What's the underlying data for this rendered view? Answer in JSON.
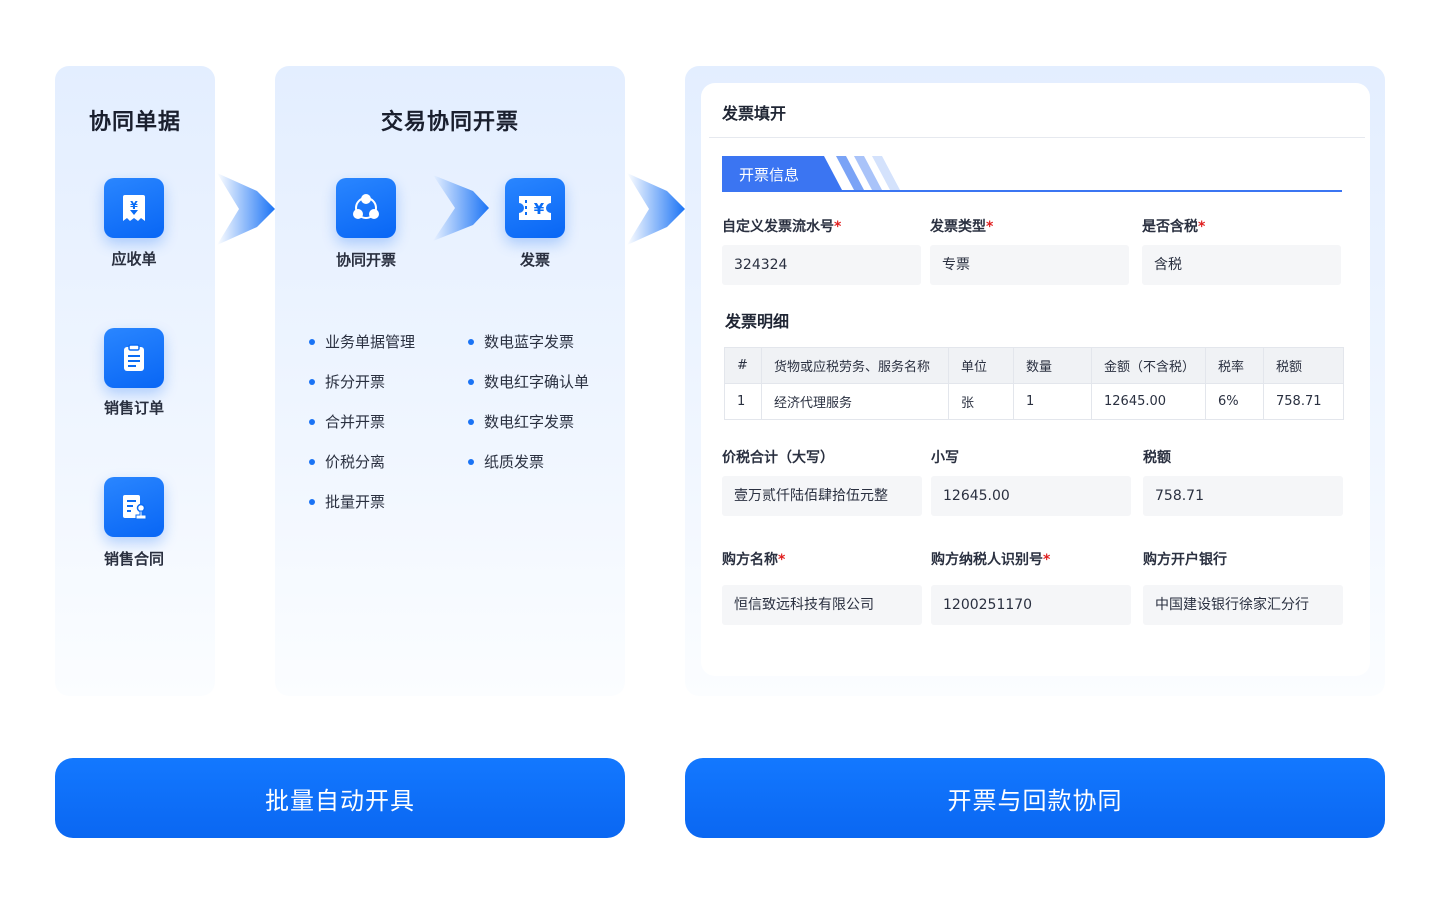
{
  "col1": {
    "title": "协同单据",
    "items": [
      {
        "label": "应收单",
        "icon": "receivable-icon"
      },
      {
        "label": "销售订单",
        "icon": "clipboard-icon"
      },
      {
        "label": "销售合同",
        "icon": "contract-icon"
      }
    ]
  },
  "col2": {
    "title": "交易协同开票",
    "nodes": [
      {
        "label": "协同开票",
        "icon": "collaboration-icon"
      },
      {
        "label": "发票",
        "icon": "invoice-icon"
      }
    ],
    "features_left": [
      "业务单据管理",
      "拆分开票",
      "合并开票",
      "价税分离",
      "批量开票"
    ],
    "features_right": [
      "数电蓝字发票",
      "数电红字确认单",
      "数电红字发票",
      "纸质发票"
    ]
  },
  "form": {
    "title": "发票填开",
    "section": "开票信息",
    "fields_row1": [
      {
        "label": "自定义发票流水号",
        "required": "*",
        "value": "324324"
      },
      {
        "label": "发票类型",
        "required": "*",
        "value": "专票"
      },
      {
        "label": "是否含税",
        "required": "*",
        "value": "含税"
      }
    ],
    "detail_heading": "发票明细",
    "table": {
      "headers": [
        "#",
        "货物或应税劳务、服务名称",
        "单位",
        "数量",
        "金额（不含税）",
        "税率",
        "税额"
      ],
      "rows": [
        [
          "1",
          "经济代理服务",
          "张",
          "1",
          "12645.00",
          "6%",
          "758.71"
        ]
      ]
    },
    "fields_row2": [
      {
        "label": "价税合计（大写）",
        "value": "壹万贰仟陆佰肆拾伍元整"
      },
      {
        "label": "小写",
        "value": "12645.00"
      },
      {
        "label": "税额",
        "value": "758.71"
      }
    ],
    "fields_row3": [
      {
        "label": "购方名称",
        "required": "*",
        "value": "恒信致远科技有限公司"
      },
      {
        "label": "购方纳税人识别号",
        "required": "*",
        "value": "1200251170"
      },
      {
        "label": "购方开户银行",
        "required": "",
        "value": "中国建设银行徐家汇分行"
      }
    ]
  },
  "buttons": {
    "left": "批量自动开具",
    "right": "开票与回款协同"
  },
  "colors": {
    "primary": "#0a6cf5",
    "panel_bg": "#e8f1ff",
    "required": "#e02020"
  }
}
